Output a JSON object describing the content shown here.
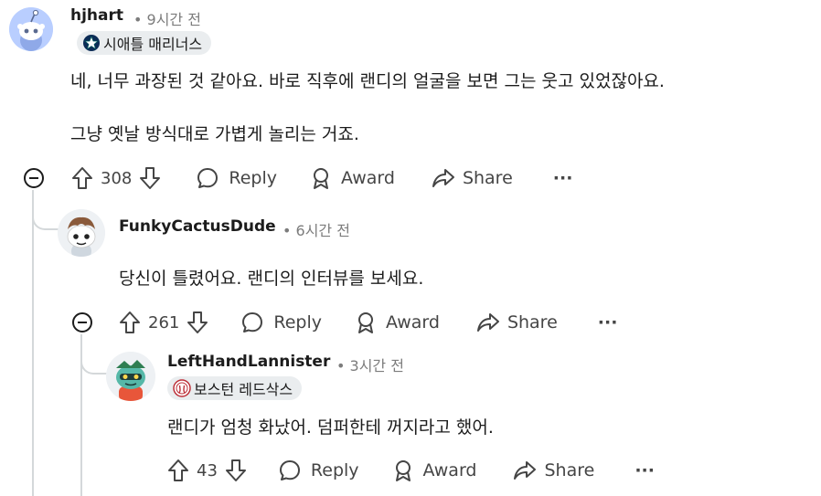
{
  "comments": [
    {
      "username": "hjhart",
      "time": "• 9시간 전",
      "flair": "시애틀 매리너스",
      "flair_icon": "seattle-mariners-star-icon",
      "lines": [
        "네, 너무 과장된 것 같아요. 바로 직후에 랜디의 얼굴을 보면 그는 웃고 있었잖아요.",
        "그냥 옛날 방식대로 가볍게 놀리는 거죠."
      ],
      "votes": "308",
      "reply": "Reply",
      "award": "Award",
      "share": "Share",
      "more": "···"
    },
    {
      "username": "FunkyCactusDude",
      "time": "• 6시간 전",
      "lines": [
        "당신이 틀렸어요. 랜디의 인터뷰를 보세요."
      ],
      "votes": "261",
      "reply": "Reply",
      "award": "Award",
      "share": "Share",
      "more": "···"
    },
    {
      "username": "LeftHandLannister",
      "time": "• 3시간 전",
      "flair": "보스턴 레드삭스",
      "flair_icon": "boston-red-sox-icon",
      "lines": [
        "랜디가 엄청 화났어. 덤퍼한테 꺼지라고 했어."
      ],
      "votes": "43",
      "reply": "Reply",
      "award": "Award",
      "share": "Share",
      "more": "···"
    }
  ],
  "colors": {
    "text": "#1c1c1c",
    "muted": "#7c7c7c",
    "action": "#454545",
    "flair_bg": "#eaedef",
    "thread": "#d4d8da"
  }
}
